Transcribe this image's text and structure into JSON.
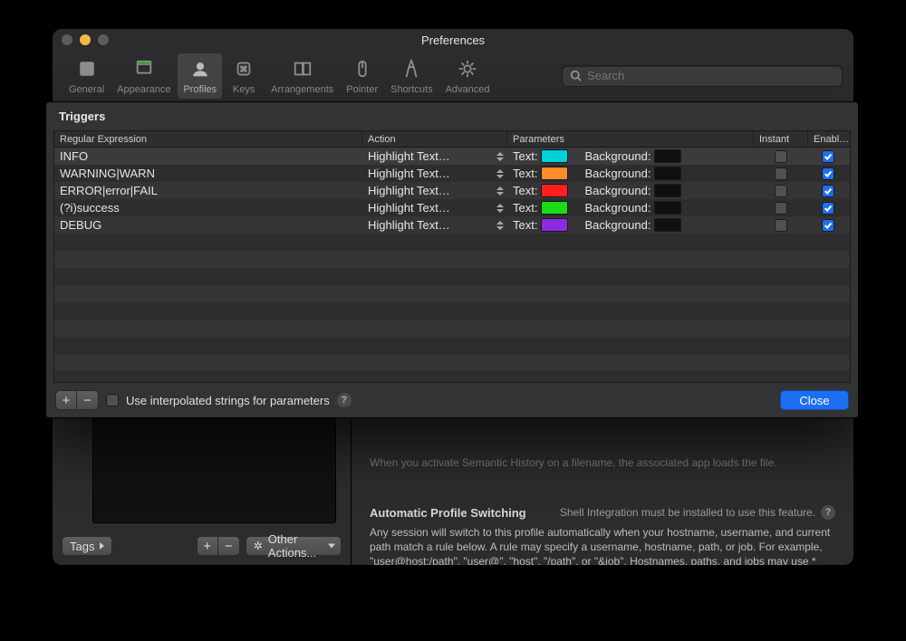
{
  "window": {
    "title": "Preferences"
  },
  "toolbar": {
    "items": [
      {
        "label": "General"
      },
      {
        "label": "Appearance"
      },
      {
        "label": "Profiles"
      },
      {
        "label": "Keys"
      },
      {
        "label": "Arrangements"
      },
      {
        "label": "Pointer"
      },
      {
        "label": "Shortcuts"
      },
      {
        "label": "Advanced"
      }
    ],
    "activeIndex": 2,
    "search_placeholder": "Search"
  },
  "sheet": {
    "title": "Triggers",
    "columns": {
      "regex": "Regular Expression",
      "action": "Action",
      "params": "Parameters",
      "instant": "Instant",
      "enabled": "Enabl…"
    },
    "param_labels": {
      "text": "Text:",
      "background": "Background:"
    },
    "rows": [
      {
        "regex": "INFO",
        "action": "Highlight Text…",
        "textColor": "#00d0d7",
        "bgColor": "#0f0f10",
        "instant": false,
        "enabled": true
      },
      {
        "regex": "WARNING|WARN",
        "action": "Highlight Text…",
        "textColor": "#ff8c2a",
        "bgColor": "#0f0f10",
        "instant": false,
        "enabled": true
      },
      {
        "regex": "ERROR|error|FAIL",
        "action": "Highlight Text…",
        "textColor": "#ff1f1f",
        "bgColor": "#0f0f10",
        "instant": false,
        "enabled": true
      },
      {
        "regex": "(?i)success",
        "action": "Highlight Text…",
        "textColor": "#1bdb1b",
        "bgColor": "#0f0f10",
        "instant": false,
        "enabled": true
      },
      {
        "regex": "DEBUG",
        "action": "Highlight Text…",
        "textColor": "#8a2be2",
        "bgColor": "#0f0f10",
        "instant": false,
        "enabled": true
      }
    ],
    "interpolated_label": "Use interpolated strings for parameters",
    "close_label": "Close"
  },
  "profile": {
    "tags_button": "Tags",
    "other_actions": "Other Actions...",
    "semantic_history_line": "When you activate Semantic History on a filename, the associated app loads the file.",
    "aps_header": "Automatic Profile Switching",
    "aps_tip": "Shell Integration must be installed to use this feature.",
    "aps_body": "Any session will switch to this profile automatically when your hostname, username, and current path match a rule below. A rule may specify a username, hostname, path, or job. For example, \"user@host:/path\", \"user@\", \"host\", \"/path\", or \"&job\". Hostnames, paths, and jobs may use * wildcards. If the rule stops matching, the profile switches back unless the rule begins with \"!\"."
  }
}
